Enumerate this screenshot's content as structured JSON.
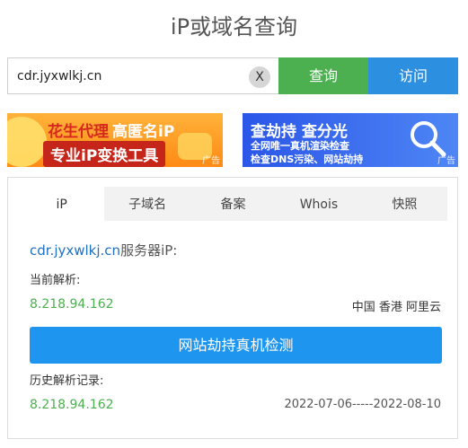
{
  "header": {
    "title": "iP或域名查询"
  },
  "search": {
    "value": "cdr.jyxwlkj.cn",
    "clear_label": "X",
    "query_label": "查询",
    "visit_label": "访问"
  },
  "ads": {
    "left": {
      "line1_red": "花生代理",
      "line1_white": "高匿名iP",
      "line2": "专业iP变换工具",
      "tag": "广告"
    },
    "right": {
      "line1": "查劫持 查分光",
      "line2": "全网唯一真机渲染检查",
      "line3": "检查DNS污染、网站劫持",
      "tag": "广告"
    }
  },
  "tabs": [
    {
      "label": "iP",
      "active": true
    },
    {
      "label": "子域名",
      "active": false
    },
    {
      "label": "备案",
      "active": false
    },
    {
      "label": "Whois",
      "active": false
    },
    {
      "label": "快照",
      "active": false
    }
  ],
  "result": {
    "domain": "cdr.jyxwlkj.cn",
    "domain_suffix": "服务器iP:",
    "current_label": "当前解析:",
    "current_ip": "8.218.94.162",
    "current_location": "中国 香港 阿里云",
    "check_button": "网站劫持真机检测",
    "history_label": "历史解析记录:",
    "history": [
      {
        "ip": "8.218.94.162",
        "range": "2022-07-06-----2022-08-10"
      }
    ]
  },
  "colors": {
    "green": "#4caf50",
    "blue": "#2d8fe0",
    "link": "#1f6fc4",
    "check_blue": "#1e96f0"
  }
}
